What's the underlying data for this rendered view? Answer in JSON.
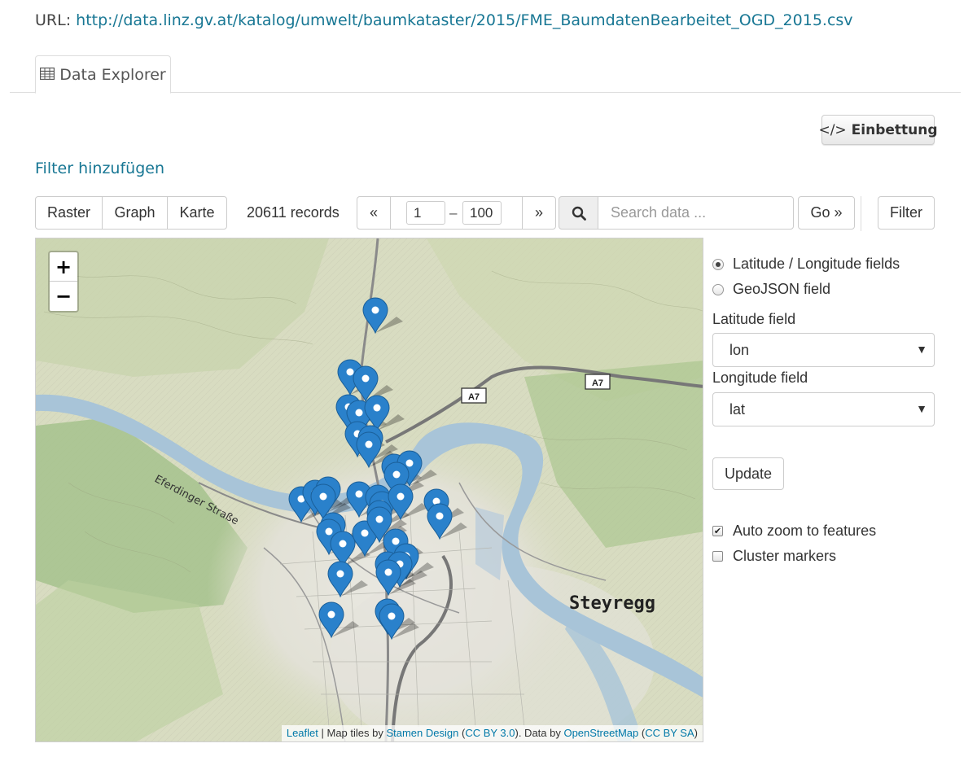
{
  "source": {
    "label": "URL:",
    "url": "http://data.linz.gv.at/katalog/umwelt/baumkataster/2015/FME_BaumdatenBearbeitet_OGD_2015.csv"
  },
  "tabs": [
    {
      "label": "Data Explorer",
      "icon": "table-icon"
    }
  ],
  "toolbar": {
    "embed_label": "Einbettung",
    "add_filter_label": "Filter hinzufügen",
    "view_buttons": [
      "Raster",
      "Graph",
      "Karte"
    ],
    "record_count": "20611 records",
    "pager": {
      "prev": "«",
      "from": "1",
      "dash": "–",
      "to": "100",
      "next": "»"
    },
    "search_placeholder": "Search data ...",
    "go_label": "Go »",
    "filter_label": "Filter"
  },
  "map": {
    "zoom_in": "+",
    "zoom_out": "−",
    "labels": {
      "city": "Steyregg",
      "road_a": "A7",
      "road_b": "A7",
      "street": "Eferdinger Straße"
    },
    "marker_color": "#2a81cb",
    "attribution": {
      "leaflet": "Leaflet",
      "sep": " | Map tiles by ",
      "stamen": "Stamen Design",
      "open1": " (",
      "ccby": "CC BY 3.0",
      "mid": "). Data by ",
      "osm": "OpenStreetMap",
      "open2": " (",
      "ccbysa": "CC BY SA",
      "close": ")"
    }
  },
  "controls": {
    "radio_latlon": "Latitude / Longitude fields",
    "radio_geojson": "GeoJSON field",
    "lat_label": "Latitude field",
    "lat_value": "lon",
    "lon_label": "Longitude field",
    "lon_value": "lat",
    "update_label": "Update",
    "auto_zoom_label": "Auto zoom to features",
    "cluster_label": "Cluster markers"
  }
}
